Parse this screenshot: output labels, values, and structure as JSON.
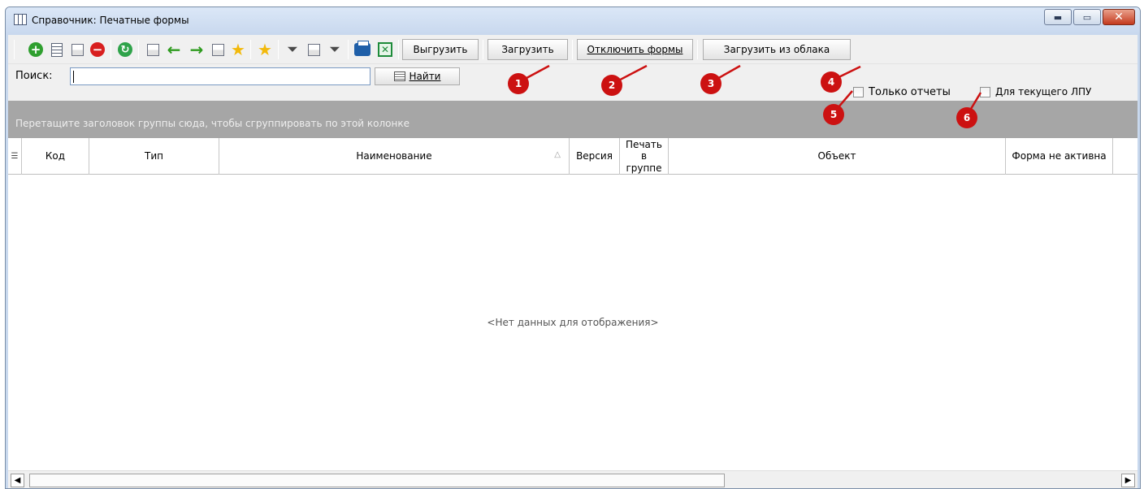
{
  "window": {
    "title": "Справочник: Печатные формы",
    "controls": [
      "minimize",
      "maximize",
      "close"
    ]
  },
  "toolbar": {
    "icons": [
      "add-icon",
      "edit-icon",
      "copy-icon",
      "delete-icon",
      "refresh-icon",
      "group-icon",
      "arrow-left-icon",
      "arrow-right-icon",
      "list-icon",
      "star-add-icon",
      "star-icon",
      "filter-icon",
      "filter-edit-icon",
      "filter-clear-icon",
      "print-icon",
      "excel-icon"
    ],
    "export_label": "Выгрузить",
    "import_label": "Загрузить",
    "disable_forms_label": "Отключить формы",
    "cloud_import_label": "Загрузить из облака"
  },
  "search": {
    "label": "Поиск:",
    "value": "",
    "find_label": "Найти"
  },
  "filters": {
    "only_reports": {
      "label": "Только отчеты",
      "checked": false
    },
    "current_lpu": {
      "label": "Для текущего ЛПУ",
      "checked": false
    }
  },
  "group_panel": {
    "hint": "Перетащите заголовок группы сюда, чтобы сгруппировать по этой колонке"
  },
  "grid": {
    "columns": [
      "Код",
      "Тип",
      "Наименование",
      "Версия",
      "Печать в группе",
      "Объект",
      "Форма не активна"
    ],
    "sort_indicator": "△",
    "empty_text": "<Нет данных для отображения>"
  },
  "callouts": [
    "1",
    "2",
    "3",
    "4",
    "5",
    "6"
  ],
  "colors": {
    "callout": "#cc1111",
    "group_panel": "#a6a6a6",
    "titlebar": "#c9d9ee"
  }
}
